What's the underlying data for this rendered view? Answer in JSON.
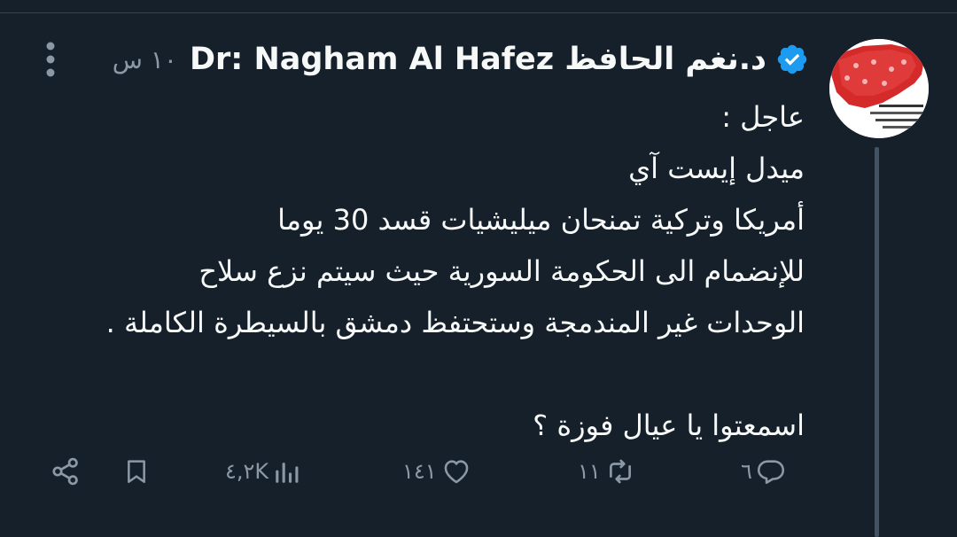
{
  "tweet": {
    "display_name": "د.نغم الحافظ Dr: Nagham Al Hafez",
    "timestamp": "١٠ س",
    "text_lines": [
      "عاجل :",
      "ميدل إيست آي",
      "أمريكا وتركية تمنحان ميليشيات قسد 30 يوما",
      "للإنضمام الى الحكومة السورية حيث سيتم نزع سلاح",
      "الوحدات غير المندمجة وستحتفظ دمشق بالسيطرة الكاملة .",
      "",
      "اسمعتوا يا عيال فوزة ؟"
    ]
  },
  "actions": {
    "replies": "٦",
    "reposts": "١١",
    "likes": "١٤١",
    "views": "٤,٢K"
  },
  "icons": {
    "avatar": "syria-map-avatar",
    "verified": "verified-badge-icon",
    "more": "more-vertical-icon",
    "reply": "reply-icon",
    "repost": "repost-icon",
    "like": "heart-icon",
    "views": "views-chart-icon",
    "bookmark": "bookmark-icon",
    "share": "share-icon"
  },
  "colors": {
    "background": "#15202b",
    "text": "#f7f9f9",
    "secondary": "#8b98a5",
    "verified": "#1d9bf0",
    "divider": "#38444d"
  }
}
